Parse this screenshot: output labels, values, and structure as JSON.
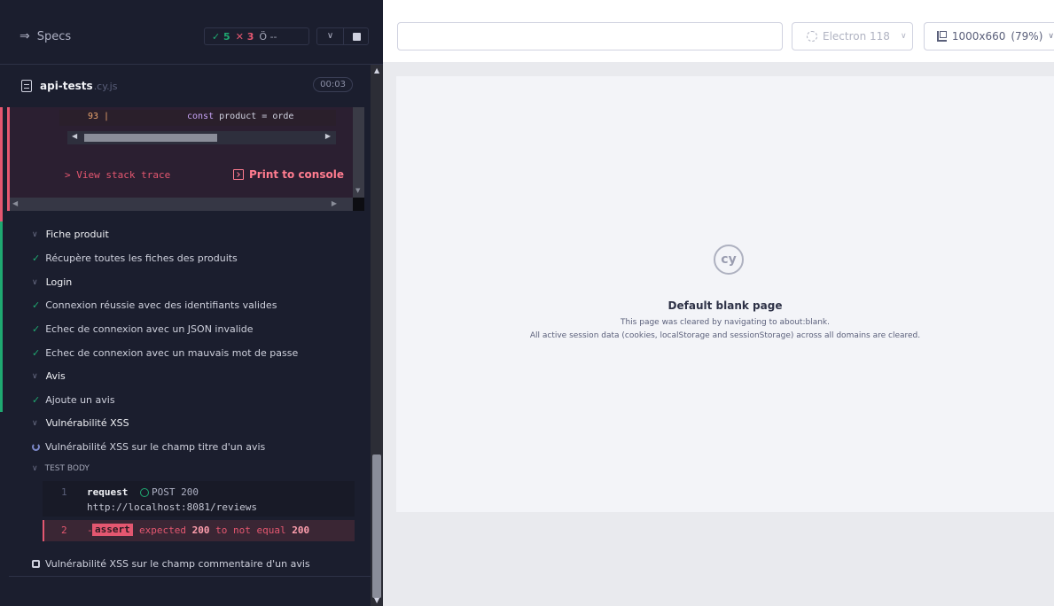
{
  "reporter": {
    "specs_label": "Specs",
    "stats": {
      "passed": "5",
      "failed": "3",
      "pending": "--"
    },
    "spec": {
      "name": "api-tests",
      "ext": ".cy.js",
      "duration": "00:03"
    },
    "error": {
      "line_number": "93 |",
      "code_keyword": "const",
      "code_rest": " product = orde",
      "view_stack_trace": "> View stack trace",
      "print_to_console": "Print to console"
    },
    "suites": [
      {
        "title": "Fiche produit",
        "tests": [
          "Récupère toutes les fiches des produits"
        ]
      },
      {
        "title": "Login",
        "tests": [
          "Connexion réussie avec des identifiants valides",
          "Echec de connexion avec un JSON invalide",
          "Echec de connexion avec un mauvais mot de passe"
        ]
      },
      {
        "title": "Avis",
        "tests": [
          "Ajoute un avis"
        ]
      },
      {
        "title": "Vulnérabilité XSS",
        "tests": [
          "Vulnérabilité XSS sur le champ titre d'un avis",
          "Vulnérabilité XSS sur le champ commentaire d'un avis"
        ]
      }
    ],
    "test_body_label": "TEST BODY",
    "commands": [
      {
        "num": "1",
        "name": "request",
        "status": "POST 200",
        "url": "http://localhost:8081/reviews"
      },
      {
        "num": "2",
        "prefix": "-",
        "badge": "assert",
        "msg_pre": "expected ",
        "msg_a": "200",
        "msg_mid": " to not equal ",
        "msg_b": "200"
      }
    ]
  },
  "aut": {
    "url_value": "",
    "browser": "Electron 118",
    "viewport": "1000x660",
    "zoom": "(79%)",
    "blank_page": {
      "logo": "cy",
      "title": "Default blank page",
      "line1": "This page was cleared by navigating to about:blank.",
      "line2": "All active session data (cookies, localStorage and sessionStorage) across all domains are cleared."
    }
  },
  "colors": {
    "pass": "#1fa971",
    "fail": "#e45770",
    "accent": "#7c88c8"
  }
}
